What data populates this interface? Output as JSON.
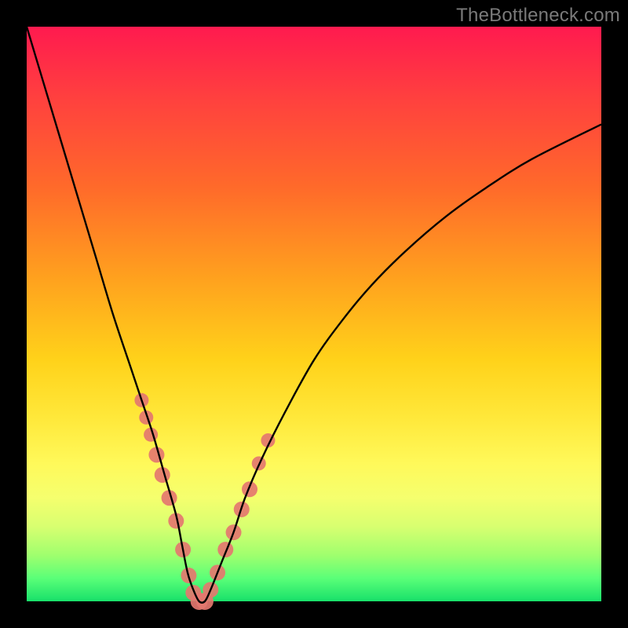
{
  "watermark": "TheBottleneck.com",
  "colors": {
    "frame": "#000000",
    "dot": "#e4776f",
    "curve": "#000000",
    "gradient_top": "#ff1a4f",
    "gradient_bottom": "#18e06a"
  },
  "chart_data": {
    "type": "line",
    "title": "",
    "xlabel": "",
    "ylabel": "",
    "xlim": [
      0,
      100
    ],
    "ylim": [
      0,
      100
    ],
    "x": [
      0,
      3,
      6,
      9,
      12,
      15,
      18,
      20,
      22,
      24,
      26,
      27,
      28,
      29,
      30,
      31,
      32,
      34,
      36,
      38,
      41,
      45,
      50,
      55,
      60,
      66,
      73,
      80,
      88,
      100
    ],
    "y": [
      100,
      90,
      80,
      70,
      60,
      50,
      41,
      35,
      29,
      22,
      15,
      10,
      5,
      2,
      0,
      0,
      2,
      7,
      12,
      18,
      25,
      33,
      42,
      49,
      55,
      61,
      67,
      72,
      77,
      83
    ],
    "markers": {
      "note": "pink-red scatter dots along both flanks of the valley",
      "x": [
        20.0,
        20.8,
        21.6,
        22.6,
        23.6,
        24.8,
        26.0,
        27.2,
        28.2,
        29.0,
        30.0,
        31.0,
        32.0,
        33.2,
        34.6,
        36.0,
        37.4,
        38.8,
        40.4,
        42.0
      ],
      "y": [
        35.0,
        32.0,
        29.0,
        25.5,
        22.0,
        18.0,
        14.0,
        9.0,
        4.5,
        1.5,
        0.0,
        0.0,
        2.0,
        5.0,
        9.0,
        12.0,
        16.0,
        19.5,
        24.0,
        28.0
      ],
      "r": [
        9,
        9,
        9,
        10,
        10,
        10,
        10,
        10,
        10,
        10,
        11,
        11,
        10,
        10,
        10,
        10,
        10,
        10,
        9,
        9
      ]
    }
  }
}
